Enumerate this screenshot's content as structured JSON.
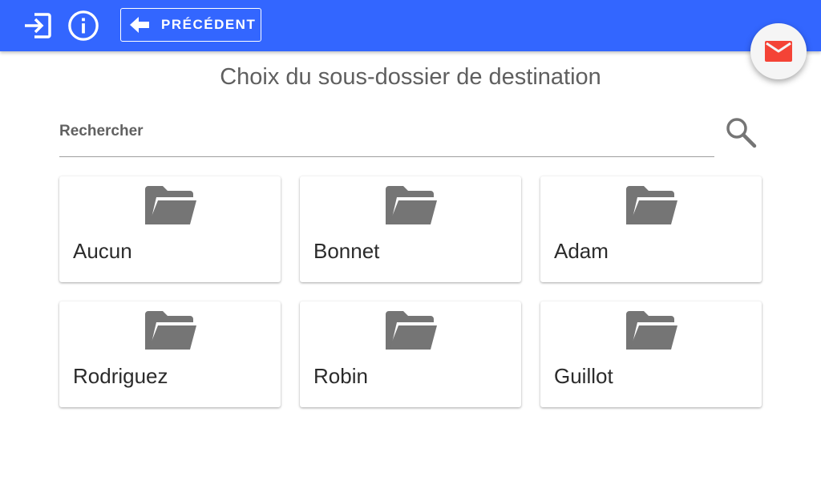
{
  "header": {
    "back_label": "PRÉCÉDENT",
    "icons": [
      "logout-icon",
      "info-icon",
      "arrow-left-icon",
      "mail-icon"
    ],
    "colors": {
      "bar": "#3366ff",
      "mail": "#f44336",
      "folder": "#757575"
    }
  },
  "page": {
    "title": "Choix du sous-dossier de destination"
  },
  "search": {
    "placeholder": "Rechercher",
    "value": "",
    "icon": "search-icon"
  },
  "folders": [
    {
      "name": "Aucun",
      "icon": "folder-open-icon"
    },
    {
      "name": "Bonnet",
      "icon": "folder-open-icon"
    },
    {
      "name": "Adam",
      "icon": "folder-open-icon"
    },
    {
      "name": "Rodriguez",
      "icon": "folder-open-icon"
    },
    {
      "name": "Robin",
      "icon": "folder-open-icon"
    },
    {
      "name": "Guillot",
      "icon": "folder-open-icon"
    }
  ]
}
